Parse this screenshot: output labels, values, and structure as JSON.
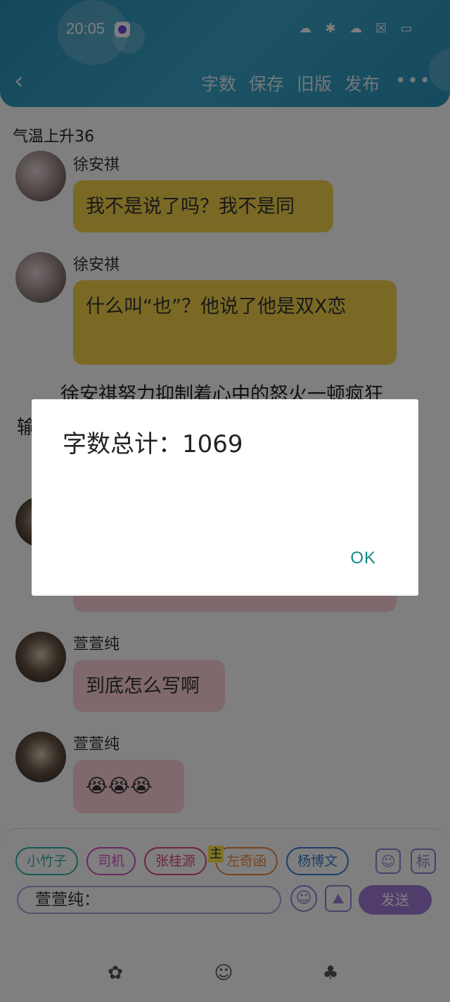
{
  "status": {
    "time": "20:05"
  },
  "header": {
    "nav": [
      "字数",
      "保存",
      "旧版",
      "发布"
    ],
    "more": "•••"
  },
  "chat": {
    "title": "气温上升36",
    "messages": [
      {
        "name": "徐安祺",
        "text": "我不是说了吗？我不是同"
      },
      {
        "name": "徐安祺",
        "text": "什么叫“也”？他说了他是双X恋"
      },
      {
        "name": "萱萱纯",
        "text": "到底怎么写啊"
      },
      {
        "name": "萱萱纯",
        "text": "😭😭😭"
      }
    ],
    "narration": "徐安祺努力抑制着心中的怒火一顿疯狂",
    "narration2": "输"
  },
  "composer": {
    "characters": [
      "小竹子",
      "司机",
      "张桂源",
      "左奇函",
      "杨博文"
    ],
    "main_tag": "主",
    "tag_button": "标",
    "input_value": "萱萱纯：",
    "send_label": "发送"
  },
  "dialog": {
    "message": "字数总计：1069",
    "ok_label": "OK"
  },
  "colors": {
    "header": "#2b8fb6",
    "gold_bubble": "#f4d34a",
    "pink_bubble": "#ffd2d9",
    "accent": "#a07bd9",
    "ok": "#138a8a"
  }
}
